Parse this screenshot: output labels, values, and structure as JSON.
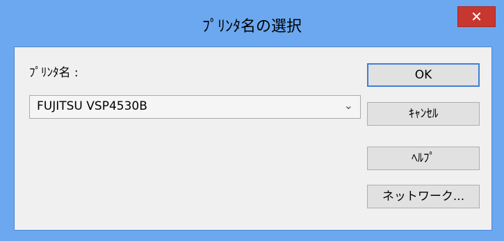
{
  "window": {
    "title": "ﾌﾟﾘﾝﾀ名の選択",
    "close_glyph": "✕"
  },
  "form": {
    "printer_label": "ﾌﾟﾘﾝﾀ名 :",
    "printer_value": "FUJITSU VSP4530B",
    "dropdown_icon": "chevron-down-icon"
  },
  "buttons": {
    "ok": "OK",
    "cancel": "ｷｬﾝｾﾙ",
    "help": "ﾍﾙﾌﾟ",
    "network": "ネットワーク..."
  },
  "colors": {
    "frame": "#6ba8f0",
    "close": "#c7372f",
    "client": "#f0f0f0",
    "default_button_border": "#3c7fd8"
  }
}
